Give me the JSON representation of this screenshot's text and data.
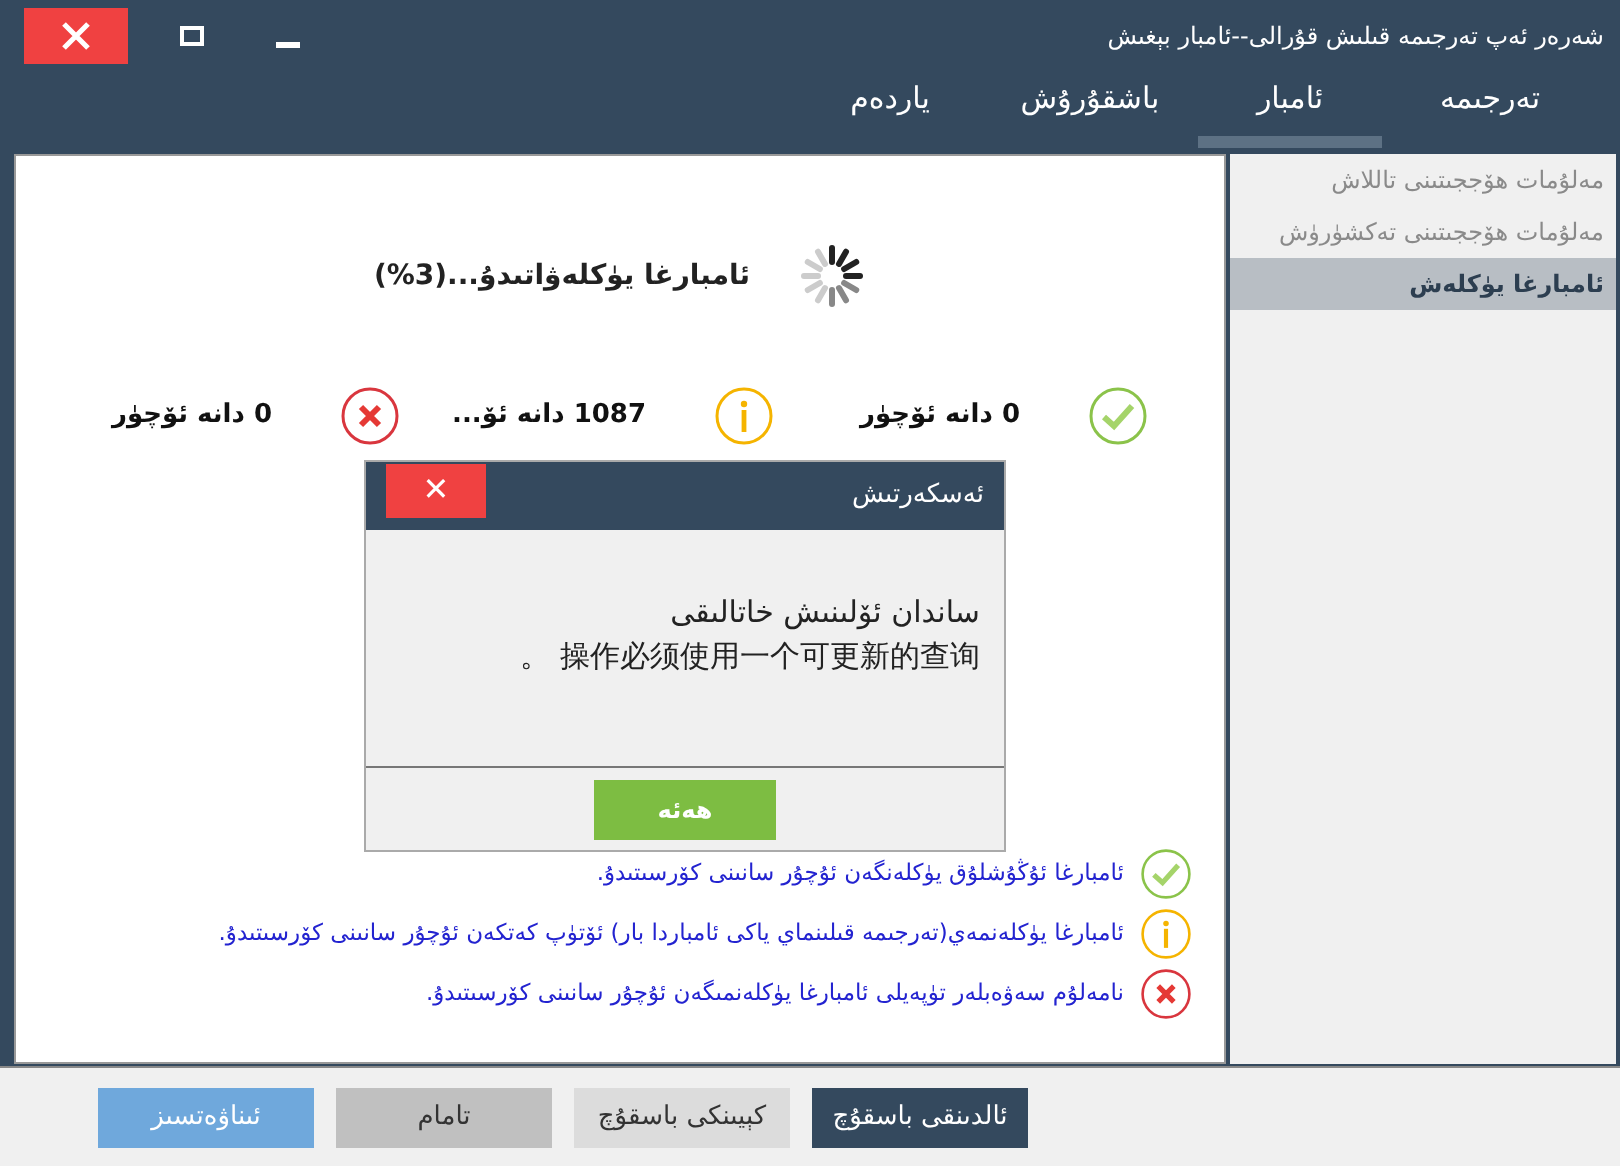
{
  "window": {
    "title": "شەرەر ئەپ تەرجىمە قىلىش قۇرالى--ئامبار بېغىش"
  },
  "tabs": [
    {
      "label": "تەرجىمە",
      "selected": false
    },
    {
      "label": "ئامبار",
      "selected": true
    },
    {
      "label": "باشقۇرۇش",
      "selected": false
    },
    {
      "label": "ياردەم",
      "selected": false
    }
  ],
  "sidebar": {
    "items": [
      {
        "label": "مەلۇمات ھۆججىتىنى تاللاش",
        "selected": false
      },
      {
        "label": "مەلۇمات ھۆججىتىنى تەكشۈرۈش",
        "selected": false
      },
      {
        "label": "ئامبارغا يۈكلەش",
        "selected": true
      }
    ]
  },
  "progress": {
    "label": "ئامبارغا يۈكلەۋاتىدۇ...(3%)"
  },
  "summary": [
    {
      "kind": "success",
      "text": "0 دانە ئۆچۈر"
    },
    {
      "kind": "info",
      "text": "1087 دانە ئۆ..."
    },
    {
      "kind": "error",
      "text": "0 دانە ئۆچۈر"
    }
  ],
  "legend": [
    {
      "kind": "success",
      "text": "ئامبارغا ئۇڭۇشلۇق يۈكلەنگەن ئۇچۇر سانىنى كۆرسىتىدۇ."
    },
    {
      "kind": "info",
      "text": "ئامبارغا يۈكلەنمەي(تەرجىمە قىلىنماي ياكى ئامباردا بار) ئۆتۈپ كەتكەن ئۇچۇر سانىنى كۆرسىتىدۇ."
    },
    {
      "kind": "error",
      "text": "نامەلۇم سەۋەبلەر تۈپەيلى ئامبارغا يۈكلەنمىگەن ئۇچۇر سانىنى كۆرسىتىدۇ."
    }
  ],
  "dialog": {
    "title": "ئەسكەرتىش",
    "close": "✕",
    "lines": [
      "ساندان ئۆلىنىش خاتالىقى",
      "操作必须使用一个可更新的查询 。"
    ],
    "button": "ھەئە"
  },
  "buttons": [
    {
      "kind": "dark",
      "label": "ئالدىنقى باسقۇچ"
    },
    {
      "kind": "light",
      "label": "كېيىنكى باسقۇچ"
    },
    {
      "kind": "gray",
      "label": "تامام"
    },
    {
      "kind": "blue",
      "label": "ئىناۋەتسىز"
    }
  ]
}
